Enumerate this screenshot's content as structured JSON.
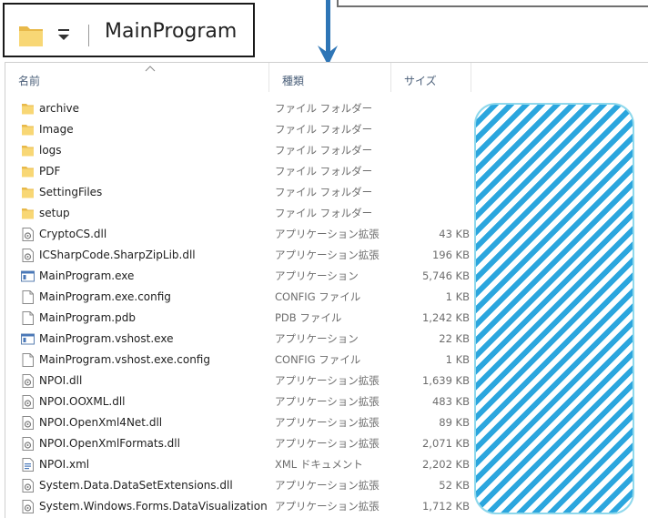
{
  "window": {
    "title": "MainProgram"
  },
  "header": {
    "name": "名前",
    "type": "種類",
    "size": "サイズ"
  },
  "files": [
    {
      "name": "archive",
      "type": "ファイル フォルダー",
      "size": "",
      "icon": "folder-icon"
    },
    {
      "name": "Image",
      "type": "ファイル フォルダー",
      "size": "",
      "icon": "folder-icon"
    },
    {
      "name": "logs",
      "type": "ファイル フォルダー",
      "size": "",
      "icon": "folder-icon"
    },
    {
      "name": "PDF",
      "type": "ファイル フォルダー",
      "size": "",
      "icon": "folder-icon"
    },
    {
      "name": "SettingFiles",
      "type": "ファイル フォルダー",
      "size": "",
      "icon": "folder-icon"
    },
    {
      "name": "setup",
      "type": "ファイル フォルダー",
      "size": "",
      "icon": "folder-icon"
    },
    {
      "name": "CryptoCS.dll",
      "type": "アプリケーション拡張",
      "size": "43 KB",
      "icon": "dll-icon"
    },
    {
      "name": "ICSharpCode.SharpZipLib.dll",
      "type": "アプリケーション拡張",
      "size": "196 KB",
      "icon": "dll-icon"
    },
    {
      "name": "MainProgram.exe",
      "type": "アプリケーション",
      "size": "5,746 KB",
      "icon": "exe-icon"
    },
    {
      "name": "MainProgram.exe.config",
      "type": "CONFIG ファイル",
      "size": "1 KB",
      "icon": "file-icon"
    },
    {
      "name": "MainProgram.pdb",
      "type": "PDB ファイル",
      "size": "1,242 KB",
      "icon": "file-icon"
    },
    {
      "name": "MainProgram.vshost.exe",
      "type": "アプリケーション",
      "size": "22 KB",
      "icon": "exe-icon"
    },
    {
      "name": "MainProgram.vshost.exe.config",
      "type": "CONFIG ファイル",
      "size": "1 KB",
      "icon": "file-icon"
    },
    {
      "name": "NPOI.dll",
      "type": "アプリケーション拡張",
      "size": "1,639 KB",
      "icon": "dll-icon"
    },
    {
      "name": "NPOI.OOXML.dll",
      "type": "アプリケーション拡張",
      "size": "483 KB",
      "icon": "dll-icon"
    },
    {
      "name": "NPOI.OpenXml4Net.dll",
      "type": "アプリケーション拡張",
      "size": "89 KB",
      "icon": "dll-icon"
    },
    {
      "name": "NPOI.OpenXmlFormats.dll",
      "type": "アプリケーション拡張",
      "size": "2,071 KB",
      "icon": "dll-icon"
    },
    {
      "name": "NPOI.xml",
      "type": "XML ドキュメント",
      "size": "2,202 KB",
      "icon": "xml-icon"
    },
    {
      "name": "System.Data.DataSetExtensions.dll",
      "type": "アプリケーション拡張",
      "size": "52 KB",
      "icon": "dll-icon"
    },
    {
      "name": "System.Windows.Forms.DataVisualization...",
      "type": "アプリケーション拡張",
      "size": "1,712 KB",
      "icon": "dll-icon"
    }
  ],
  "colors": {
    "folder": "#f8d775",
    "accent": "#2ba6de",
    "arrow": "#2e75b6"
  }
}
